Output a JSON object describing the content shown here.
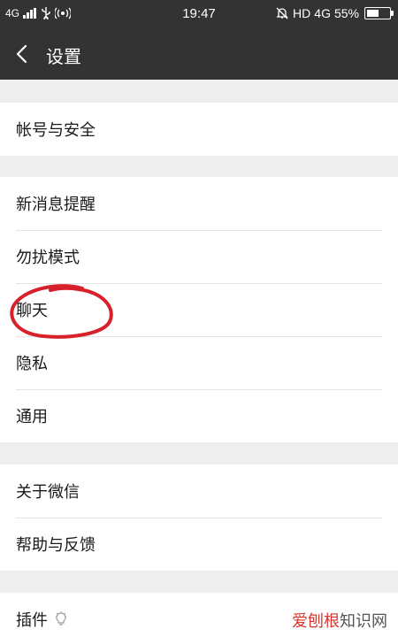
{
  "status_bar": {
    "left_network": "4G",
    "time": "19:47",
    "hd_label": "HD",
    "right_network": "4G",
    "battery_percent_label": "55%",
    "battery_level": 0.55
  },
  "nav": {
    "title": "设置"
  },
  "groups": [
    {
      "items": [
        {
          "label": "帐号与安全"
        }
      ]
    },
    {
      "items": [
        {
          "label": "新消息提醒"
        },
        {
          "label": "勿扰模式"
        },
        {
          "label": "聊天"
        },
        {
          "label": "隐私"
        },
        {
          "label": "通用"
        }
      ]
    },
    {
      "items": [
        {
          "label": "关于微信"
        },
        {
          "label": "帮助与反馈"
        }
      ]
    },
    {
      "items": [
        {
          "label": "插件",
          "icon": "lightbulb-icon"
        }
      ]
    }
  ],
  "annotation_color": "#d8202a",
  "watermark": {
    "brand": "爱刨根",
    "suffix": "知识网"
  }
}
